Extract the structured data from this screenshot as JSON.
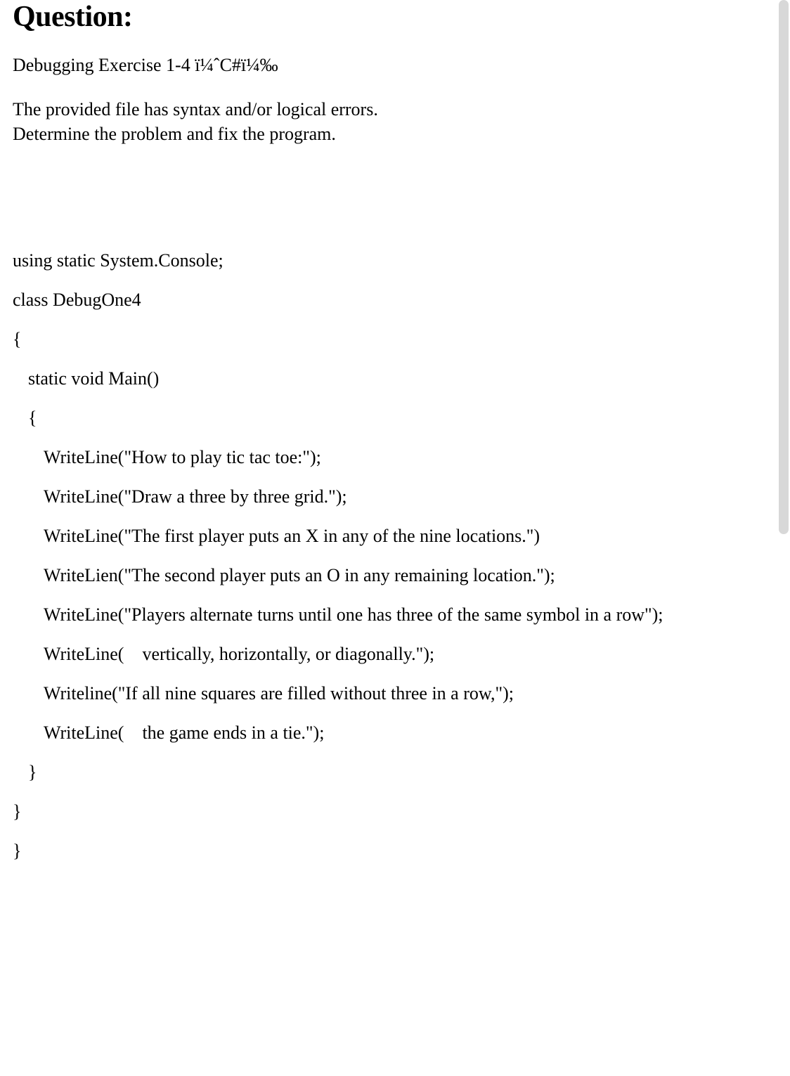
{
  "heading": "Question:",
  "intro": "Debugging Exercise 1-4 ï¼ˆC#ï¼‰",
  "description": [
    "The provided file has syntax and/or logical errors.",
    "Determine the problem and fix the program."
  ],
  "code": {
    "lines": [
      {
        "text": "using static System.Console;",
        "indent": 0
      },
      {
        "text": "class DebugOne4",
        "indent": 0
      },
      {
        "text": "{",
        "indent": 0
      },
      {
        "text": "static void Main()",
        "indent": 1
      },
      {
        "text": "{",
        "indent": 1
      },
      {
        "text": "WriteLine(\"How to play tic tac toe:\");",
        "indent": 2
      },
      {
        "text": "WriteLine(\"Draw a three by three grid.\");",
        "indent": 2
      },
      {
        "text": "WriteLine(\"The first player puts an X in any of the nine locations.\")",
        "indent": 2
      },
      {
        "text": "WriteLien(\"The second player puts an O in any remaining location.\");",
        "indent": 2
      },
      {
        "text": "WriteLine(\"Players alternate turns until one has three of the same symbol in a row\");",
        "indent": 2
      },
      {
        "text": "WriteLine(    vertically, horizontally, or diagonally.\");",
        "indent": 2
      },
      {
        "text": "Writeline(\"If all nine squares are filled without three in a row,\");",
        "indent": 2
      },
      {
        "text": "WriteLine(    the game ends in a tie.\");",
        "indent": 2
      },
      {
        "text": "}",
        "indent": 1
      },
      {
        "text": "}",
        "indent": 0
      },
      {
        "text": "}",
        "indent": 0
      }
    ]
  }
}
